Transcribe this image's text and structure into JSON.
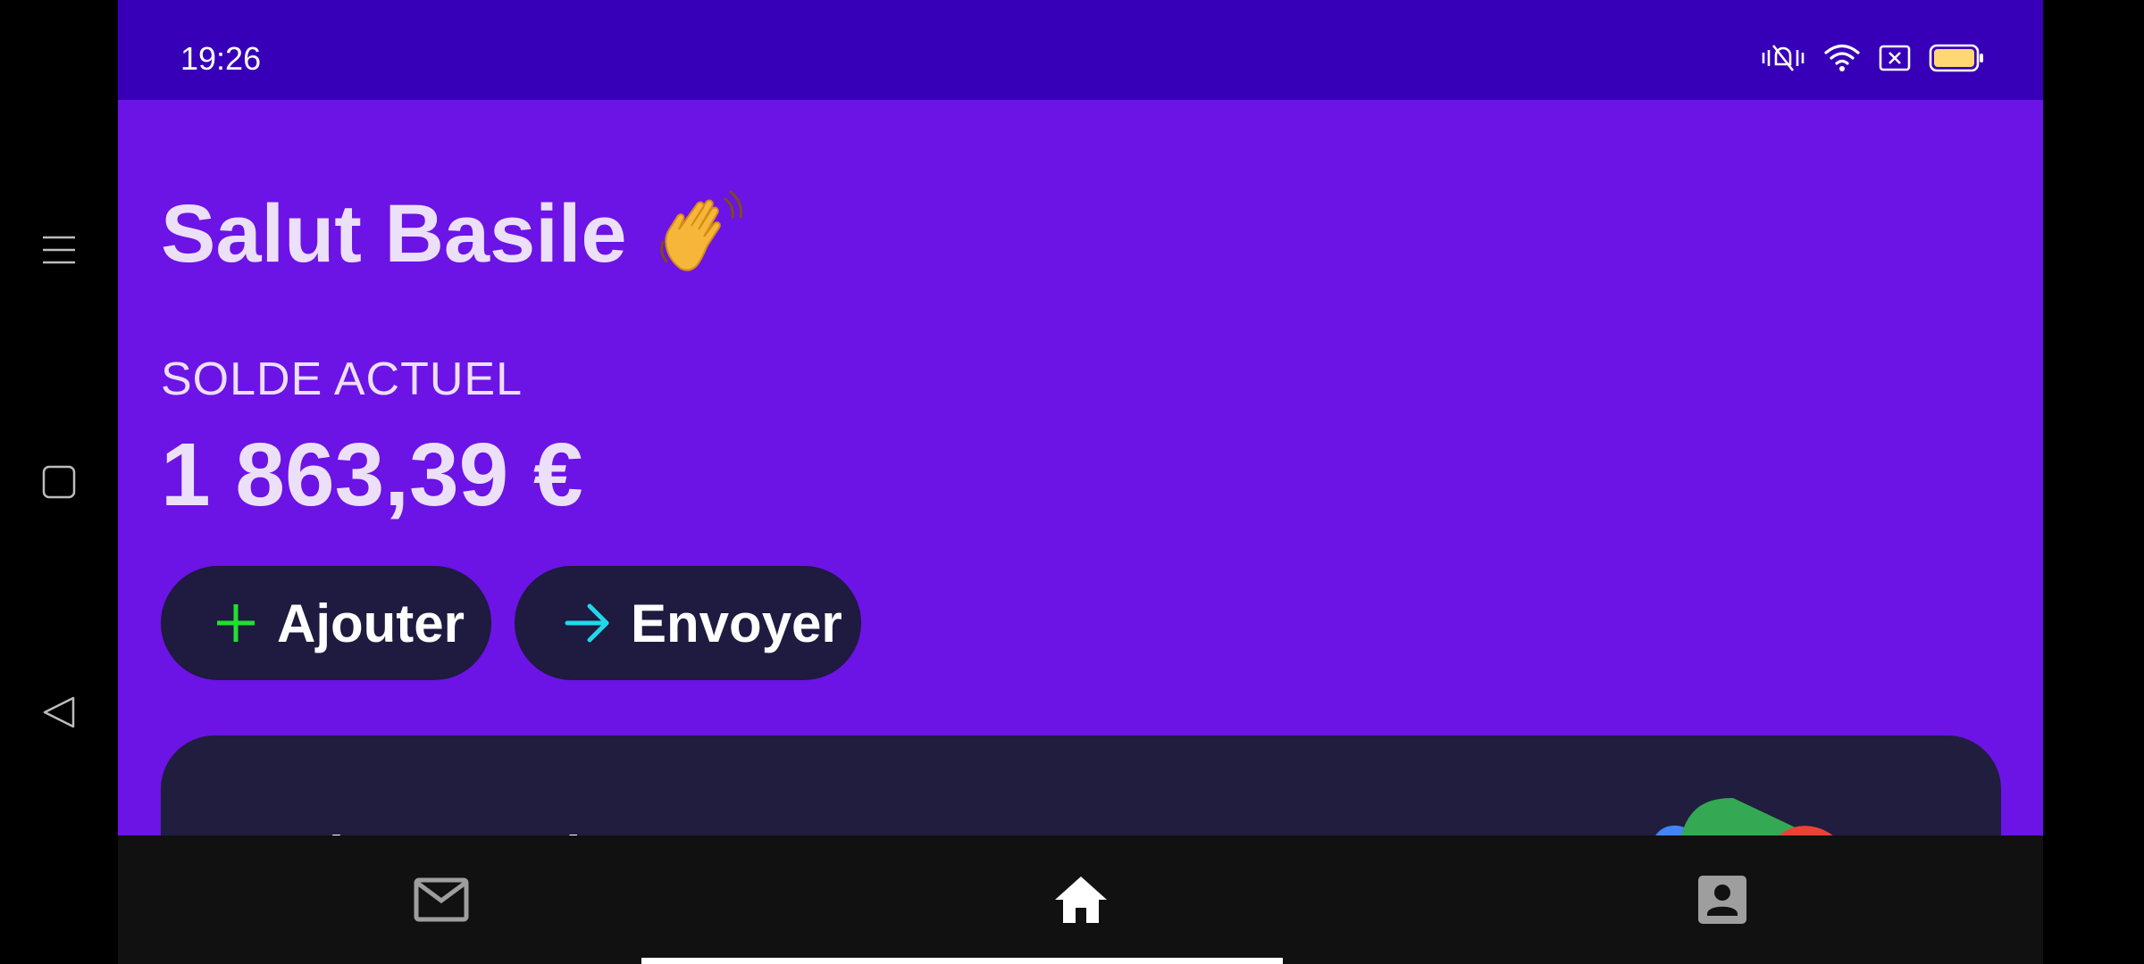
{
  "status_bar": {
    "time": "19:26",
    "icons": [
      "mute-vibrate-icon",
      "wifi-icon",
      "sim-off-icon",
      "battery-icon"
    ]
  },
  "system_nav": {
    "buttons": [
      "menu-icon",
      "square-icon",
      "back-triangle-icon"
    ]
  },
  "header": {
    "greeting": "Salut Basile",
    "greeting_emoji": "waving-hand-icon"
  },
  "balance": {
    "label": "SOLDE ACTUEL",
    "amount": "1 863,39 €"
  },
  "actions": {
    "add_label": "Ajouter",
    "send_label": "Envoyer"
  },
  "promo_card": {
    "title": "Active Google Pay",
    "art": "google-pay-wallet-icon"
  },
  "bottom_nav": {
    "items": [
      "mail-icon",
      "home-icon",
      "profile-icon"
    ],
    "active": "home-icon"
  },
  "colors": {
    "background": "#6c13e6",
    "status_bar": "#3700b8",
    "button_bg": "#1e1a40",
    "plus_accent": "#21e02f",
    "arrow_accent": "#21d8ea",
    "text_light": "#ecdff8",
    "nav_bg": "#111111"
  }
}
